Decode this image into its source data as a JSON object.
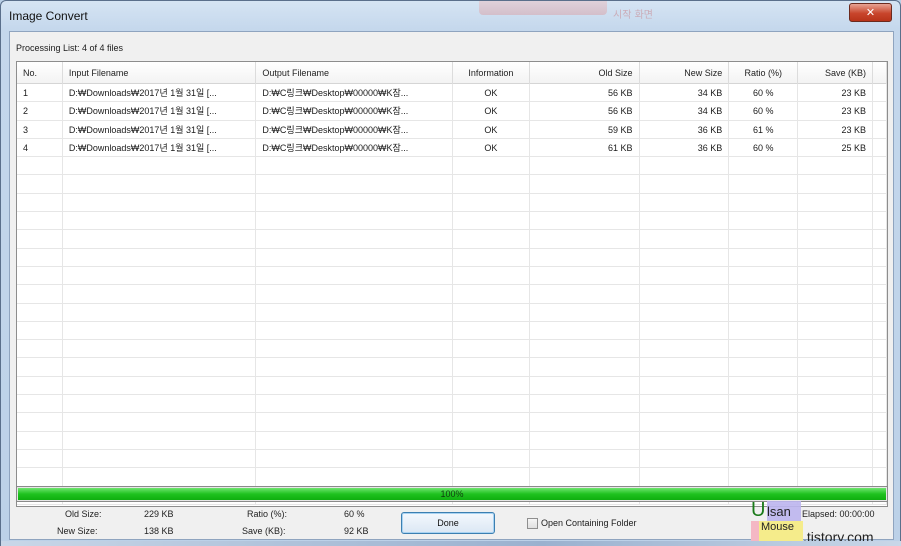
{
  "window": {
    "title": "Image Convert",
    "close_glyph": "✕"
  },
  "processing_label": "Processing List: 4 of 4 files",
  "table": {
    "columns": [
      "No.",
      "Input Filename",
      "Output Filename",
      "Information",
      "Old Size",
      "New Size",
      "Ratio (%)",
      "Save (KB)"
    ],
    "rows": [
      [
        "1",
        "D:₩Downloads₩2017년 1월 31일 [...",
        "D:₩C링크₩Desktop₩00000₩K잠...",
        "OK",
        "56 KB",
        "34 KB",
        "60 %",
        "23 KB"
      ],
      [
        "2",
        "D:₩Downloads₩2017년 1월 31일 [...",
        "D:₩C링크₩Desktop₩00000₩K잠...",
        "OK",
        "56 KB",
        "34 KB",
        "60 %",
        "23 KB"
      ],
      [
        "3",
        "D:₩Downloads₩2017년 1월 31일 [...",
        "D:₩C링크₩Desktop₩00000₩K잠...",
        "OK",
        "59 KB",
        "36 KB",
        "61 %",
        "23 KB"
      ],
      [
        "4",
        "D:₩Downloads₩2017년 1월 31일 [...",
        "D:₩C링크₩Desktop₩00000₩K잠...",
        "OK",
        "61 KB",
        "36 KB",
        "60 %",
        "25 KB"
      ]
    ]
  },
  "progress": {
    "percent": 100,
    "label": "100%"
  },
  "stats": {
    "old_size_label": "Old Size:",
    "old_size_value": "229 KB",
    "new_size_label": "New Size:",
    "new_size_value": "138 KB",
    "ratio_label": "Ratio (%):",
    "ratio_value": "60 %",
    "save_label": "Save (KB):",
    "save_value": "92 KB"
  },
  "done_label": "Done",
  "open_folder_label": "Open Containing Folder",
  "elapsed": "Elapsed: 00:00:00",
  "watermark": {
    "u": "U",
    "ilsan": "lsan",
    "mouse": "Mouse",
    "tistory": ".tistory.com"
  },
  "title_blur_text": "시작 화면",
  "colors": {
    "progress_green": "#1fc21f",
    "close_red": "#c8452c"
  }
}
